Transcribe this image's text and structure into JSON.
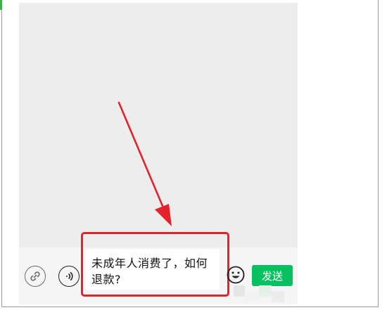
{
  "input_bar": {
    "message_text": "未成年人消费了，如何退款?",
    "send_label": "发送"
  },
  "icons": {
    "link": "link-icon",
    "voice": "voice-icon",
    "emoji": "emoji-icon",
    "annotation_arrow": "arrow-icon"
  },
  "colors": {
    "chat_background": "#ededed",
    "input_bar_background": "#f5f5f5",
    "send_button": "#07c160",
    "annotation": "#e3232a"
  }
}
